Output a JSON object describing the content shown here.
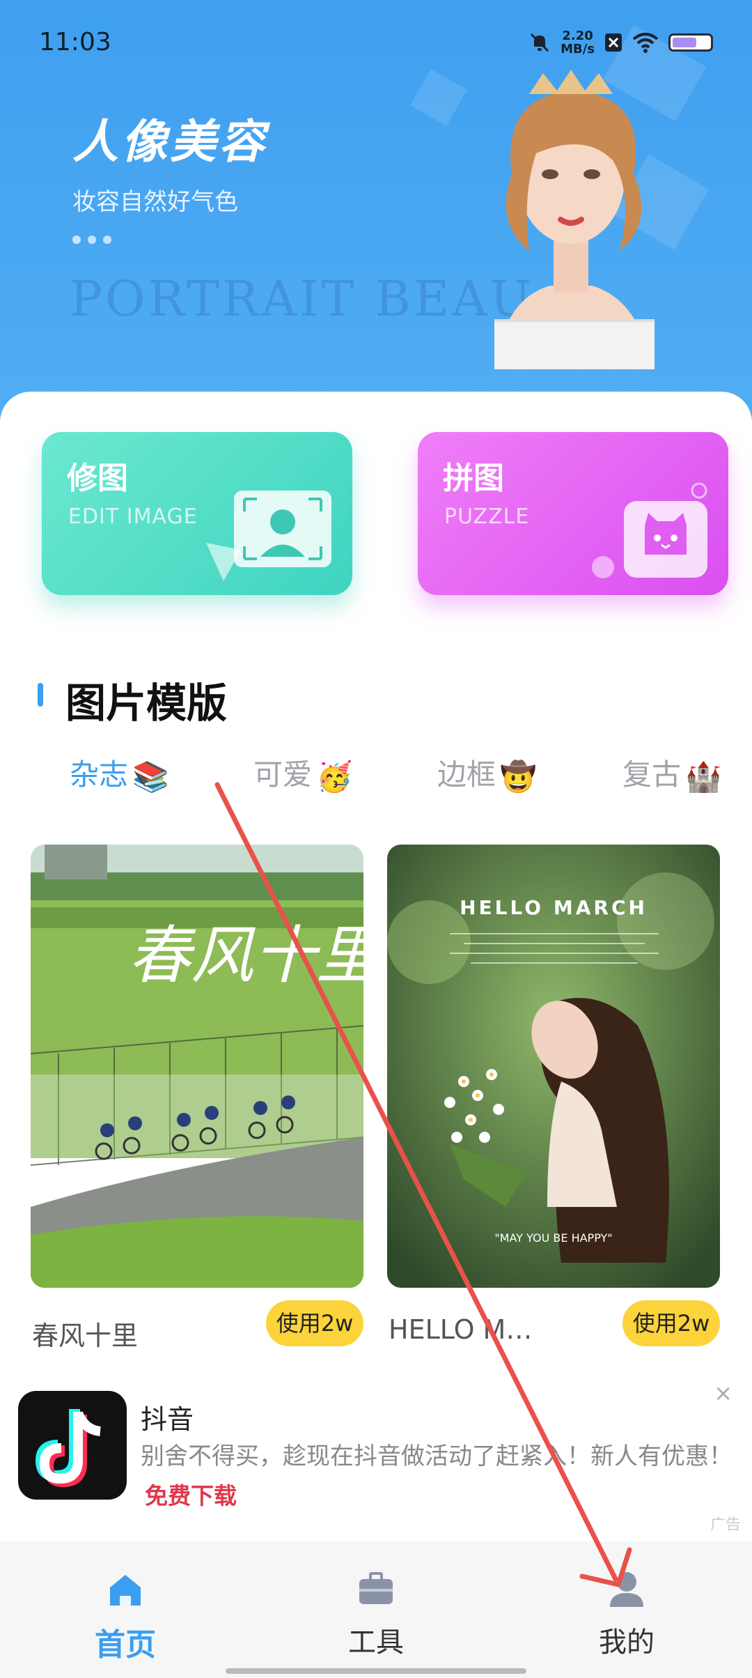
{
  "status_bar": {
    "time": "11:03",
    "net_speed_value": "2.20",
    "net_speed_unit": "MB/s",
    "icons": [
      "bell-off-icon",
      "close-box-icon",
      "wifi-icon",
      "battery-icon"
    ]
  },
  "banner": {
    "title": "人像美容",
    "subtitle": "妆容自然好气色",
    "watermark": "PORTRAIT BEAU"
  },
  "features": {
    "edit": {
      "title": "修图",
      "subtitle": "EDIT IMAGE"
    },
    "puzzle": {
      "title": "拼图",
      "subtitle": "PUZZLE"
    }
  },
  "templates": {
    "section_title": "图片模版",
    "tabs": [
      {
        "label": "杂志",
        "emoji": "📚",
        "active": true
      },
      {
        "label": "可爱",
        "emoji": "🥳",
        "active": false
      },
      {
        "label": "边框",
        "emoji": "🤠",
        "active": false
      },
      {
        "label": "复古",
        "emoji": "🏰",
        "active": false
      }
    ],
    "items": [
      {
        "name": "春风十里",
        "button": "使用2w",
        "art_text": "春风十里"
      },
      {
        "name": "HELLO M…",
        "button": "使用2w",
        "art_title": "HELLO MARCH",
        "art_caption": "\"MAY YOU BE HAPPY\""
      }
    ]
  },
  "ad": {
    "app_name": "抖音",
    "description": "别舍不得买，趁现在抖音做活动了赶紧入！新人有优惠！",
    "cta": "免费下载",
    "close": "×",
    "tag": "广告"
  },
  "bottom_nav": [
    {
      "label": "首页",
      "icon": "home-icon",
      "active": true
    },
    {
      "label": "工具",
      "icon": "toolbox-icon",
      "active": false
    },
    {
      "label": "我的",
      "icon": "user-icon",
      "active": false
    }
  ],
  "colors": {
    "accent": "#3b9ef0",
    "banner": "#4aa6f2",
    "use_button": "#fcd33a",
    "annotation_arrow": "#e8524a"
  }
}
